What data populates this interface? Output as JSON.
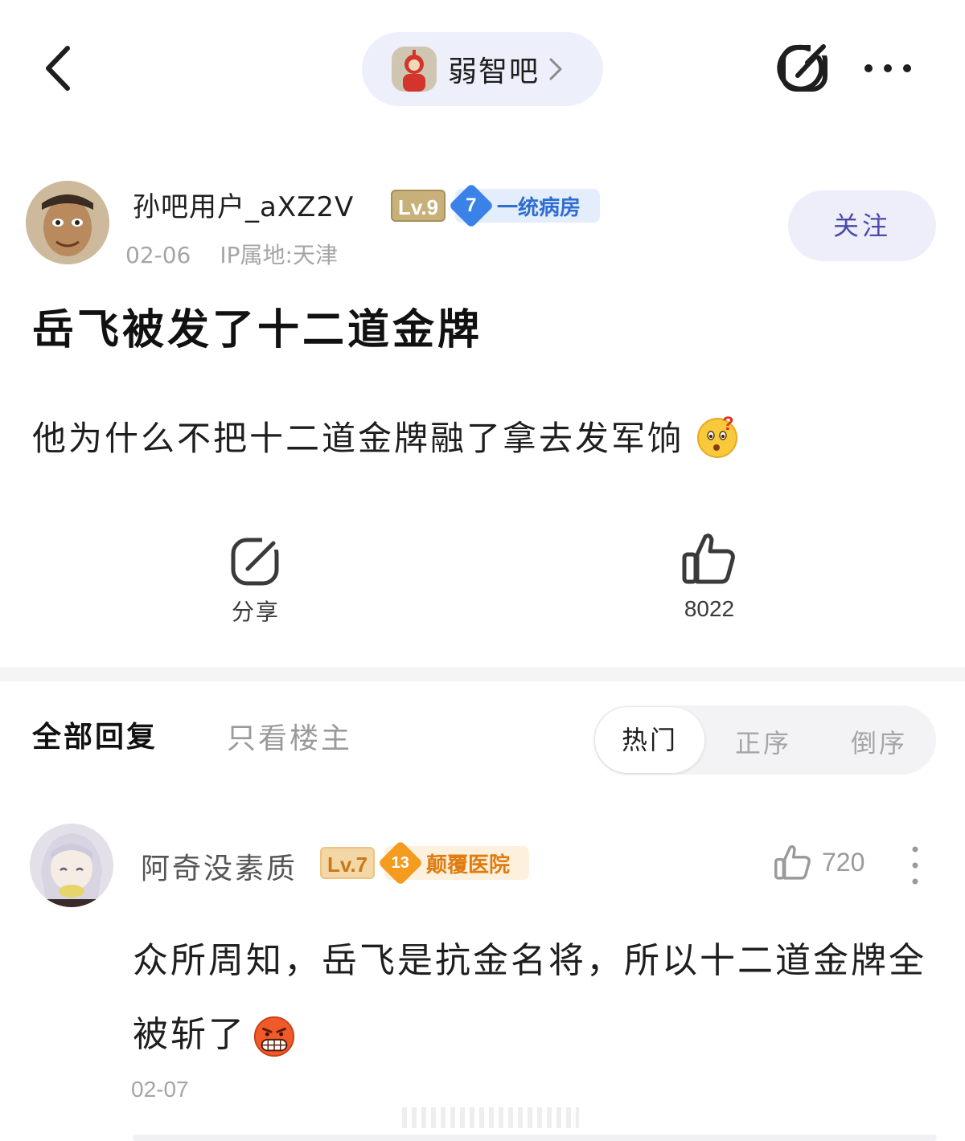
{
  "topbar": {
    "forum_name": "弱智吧",
    "icons": [
      "back-arrow-icon",
      "chevron-right-icon",
      "share-icon",
      "more-icon"
    ]
  },
  "post": {
    "author": {
      "name": "孙吧用户_aXZ2V",
      "level": "Lv.9",
      "fan_level": "7",
      "fan_title": "一统病房",
      "date": "02-06",
      "ip": "IP属地:天津"
    },
    "follow_label": "关注",
    "title": "岳飞被发了十二道金牌",
    "body": "他为什么不把十二道金牌融了拿去发军饷",
    "body_emoji": "thinking-face-emoji",
    "share_label": "分享",
    "like_count": "8022"
  },
  "replies_header": {
    "tab_all": "全部回复",
    "tab_op_only": "只看楼主",
    "sort_options": [
      "热门",
      "正序",
      "倒序"
    ],
    "sort_selected": "热门"
  },
  "replies": [
    {
      "name": "阿奇没素质",
      "level": "Lv.7",
      "fan_level": "13",
      "fan_title": "颠覆医院",
      "like_count": "720",
      "text": "众所周知，岳飞是抗金名将，所以十二道金牌全被斩了",
      "text_emoji": "angry-grimace-emoji",
      "date": "02-07"
    }
  ],
  "colors": {
    "follow_bg": "#eeeefa",
    "follow_text": "#4b4ba8",
    "forum_pill_bg": "#edf0fb",
    "fan_badge_blue": "#3b82e8",
    "fan_badge_orange": "#f39c1f"
  }
}
